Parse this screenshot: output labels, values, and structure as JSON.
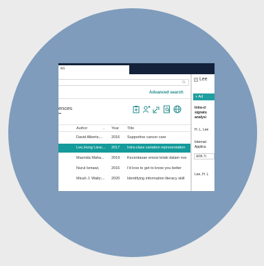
{
  "window": {
    "tab_label": "es"
  },
  "search": {
    "placeholder": "",
    "advanced_label": "Advanced search"
  },
  "library": {
    "title": "ences"
  },
  "table": {
    "columns": {
      "author": "Author",
      "year": "Year",
      "title": "Title"
    },
    "rows": [
      {
        "author": "David Alberts;...",
        "year": "2016",
        "title": "Supportive cancer care",
        "selected": false
      },
      {
        "author": "Lee,Hung Liew;...",
        "year": "2017",
        "title": "Intra-class variation representation",
        "selected": true
      },
      {
        "author": "Maznida Maha...",
        "year": "2019",
        "title": "Kecerdasan emosi lelaki dalam nov",
        "selected": false
      },
      {
        "author": "Nurul Ismawi,",
        "year": "2016",
        "title": "I'd love to get to know you better",
        "selected": false
      },
      {
        "author": "Micah J. Waltz;...",
        "year": "2020",
        "title": "Identifying information literacy skill",
        "selected": false
      }
    ]
  },
  "detail": {
    "title": "Lee",
    "add_button": "+ Ad",
    "heading_lines": [
      "Intra-cl",
      "signatu",
      "analysi"
    ],
    "authors": "H. L. Lee",
    "journal_lines": [
      "Internat",
      "Applica"
    ],
    "style_box": "APA 7t",
    "citation": "Lee, H. L"
  },
  "colors": {
    "background": "#ebebeb",
    "circle": "#7f9cbc",
    "topbar": "#14213a",
    "accent": "#149a9a",
    "link": "#1f8a8a"
  }
}
